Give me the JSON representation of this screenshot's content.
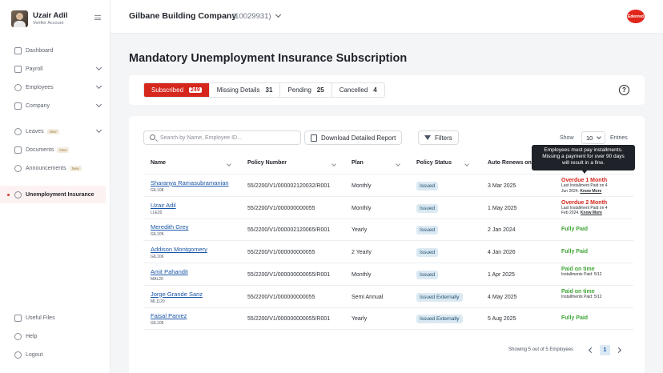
{
  "profile": {
    "name": "Uzair Adil",
    "role": "Verifier Account"
  },
  "sidebar": {
    "items": [
      {
        "label": "Dashboard"
      },
      {
        "label": "Payroll"
      },
      {
        "label": "Employees"
      },
      {
        "label": "Company"
      },
      {
        "label": "Leaves",
        "badge": "New"
      },
      {
        "label": "Documents",
        "badge": "New"
      },
      {
        "label": "Announcements",
        "badge": "New"
      },
      {
        "label": "Unemployment Insurance"
      }
    ],
    "bottom": [
      {
        "label": "Useful Files"
      },
      {
        "label": "Help"
      },
      {
        "label": "Logout"
      }
    ]
  },
  "header": {
    "company": "Gilbane Building Company",
    "company_id": "(10029931)",
    "logo_text": "Edenred"
  },
  "page": {
    "title": "Mandatory Unemployment Insurance Subscription"
  },
  "tabs": [
    {
      "label": "Subscribed",
      "count": "249"
    },
    {
      "label": "Missing Details",
      "count": "31"
    },
    {
      "label": "Pending",
      "count": "25"
    },
    {
      "label": "Cancelled",
      "count": "4"
    }
  ],
  "help": {
    "symbol": "?"
  },
  "toolbar": {
    "search_placeholder": "Search by Name, Employee ID...",
    "download_label": "Download Detailed Report",
    "filters_label": "Filters",
    "show_label": "Show",
    "show_value": "10",
    "entries_label": "Entries"
  },
  "table": {
    "columns": [
      "Name",
      "Policy Number",
      "Plan",
      "Policy Status",
      "Auto Renews on"
    ],
    "rows": [
      {
        "name": "Sharanya Ramasubramanian",
        "code": "GIL108",
        "policy": "55/2200/V1/000002120032/R001",
        "plan": "Monthly",
        "status": "Issued",
        "renews": "3 Mar 2025",
        "renew_title": "Overdue 1 Month",
        "renew_sub1": "Last Installment Paid on 4",
        "renew_sub2": "Jun 2024.",
        "renew_link": "Know More",
        "tone": "red"
      },
      {
        "name": "Uzair Adil",
        "code": "LLE20",
        "policy": "55/2200/V1/000000000055",
        "plan": "Monthly",
        "status": "Issued",
        "renews": "1 May 2025",
        "renew_title": "Overdue 2 Month",
        "renew_sub1": "Last Installment Paid on 4",
        "renew_sub2": "Feb 2024.",
        "renew_link": "Know More",
        "tone": "red"
      },
      {
        "name": "Meredith Grey",
        "code": "GIL105",
        "policy": "55/2200/V1/000002120065/R001",
        "plan": "Yearly",
        "status": "Issued",
        "renews": "2 Jan 2024",
        "renew_title": "Fully Paid",
        "renew_sub1": "",
        "renew_sub2": "",
        "renew_link": "",
        "tone": "green"
      },
      {
        "name": "Addison Montgomery",
        "code": "GIL106",
        "policy": "55/2200/V1/000000000055",
        "plan": "2 Yearly",
        "status": "Issued",
        "renews": "4 Jan 2026",
        "renew_title": "Fully Paid",
        "renew_sub1": "",
        "renew_sub2": "",
        "renew_link": "",
        "tone": "green"
      },
      {
        "name": "Amit Pahandit",
        "code": "MAL20",
        "policy": "55/2200/V1/000000000055/R001",
        "plan": "Monthly",
        "status": "Issued",
        "renews": "1 Apr 2025",
        "renew_title": "Paid on time",
        "renew_sub1": "Installments Paid: 5/12",
        "renew_sub2": "",
        "renew_link": "",
        "tone": "green"
      },
      {
        "name": "Jorge Grande Sanz",
        "code": "ML1120",
        "policy": "55/2200/V1/000000000055",
        "plan": "Semi Annual",
        "status": "Issued Externally",
        "renews": "4 May 2025",
        "renew_title": "Paid on time",
        "renew_sub1": "Installments Paid: 5/12",
        "renew_sub2": "",
        "renew_link": "",
        "tone": "green"
      },
      {
        "name": "Faisal Parvez",
        "code": "GIL105",
        "policy": "55/2200/V1/000000000055/R001",
        "plan": "Yearly",
        "status": "Issued Externally",
        "renews": "5 Aug 2025",
        "renew_title": "Fully Paid",
        "renew_sub1": "",
        "renew_sub2": "",
        "renew_link": "",
        "tone": "green"
      }
    ]
  },
  "tooltip": {
    "line1": "Employees must pay installments.",
    "line2": "Missing a payment for over 90 days",
    "line3": "will result in a fine."
  },
  "pagination": {
    "summary": "Showing 5 out of 5 Employees",
    "page": "1"
  }
}
